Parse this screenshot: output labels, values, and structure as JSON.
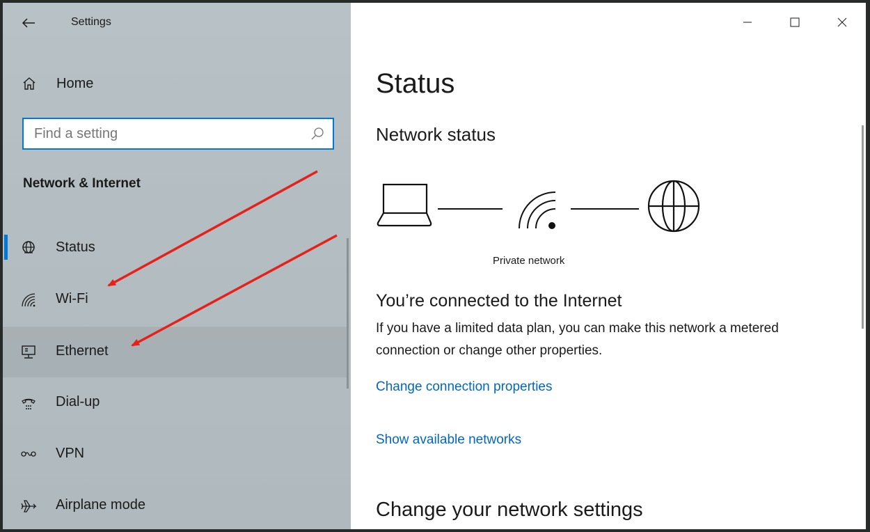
{
  "app": {
    "title": "Settings"
  },
  "sidebar": {
    "home_label": "Home",
    "search": {
      "placeholder": "Find a setting",
      "value": ""
    },
    "section_heading": "Network & Internet",
    "items": [
      {
        "label": "Status",
        "icon": "globe-status-icon",
        "active": true
      },
      {
        "label": "Wi-Fi",
        "icon": "wifi-icon"
      },
      {
        "label": "Ethernet",
        "icon": "ethernet-icon",
        "hovered": true
      },
      {
        "label": "Dial-up",
        "icon": "dialup-icon"
      },
      {
        "label": "VPN",
        "icon": "vpn-icon"
      },
      {
        "label": "Airplane mode",
        "icon": "airplane-icon"
      }
    ]
  },
  "window_controls": {
    "minimize": "minimize-icon",
    "maximize": "maximize-icon",
    "close": "close-icon"
  },
  "main": {
    "title": "Status",
    "network_status_heading": "Network status",
    "network_label": "Private network",
    "connected_heading": "You’re connected to the Internet",
    "connected_description": "If you have a limited data plan, you can make this network a metered connection or change other properties.",
    "links": [
      "Change connection properties",
      "Show available networks"
    ],
    "change_settings_heading": "Change your network settings"
  },
  "colors": {
    "accent": "#0078d7",
    "link": "#0067c0",
    "annotation_arrow": "#e8201a"
  }
}
